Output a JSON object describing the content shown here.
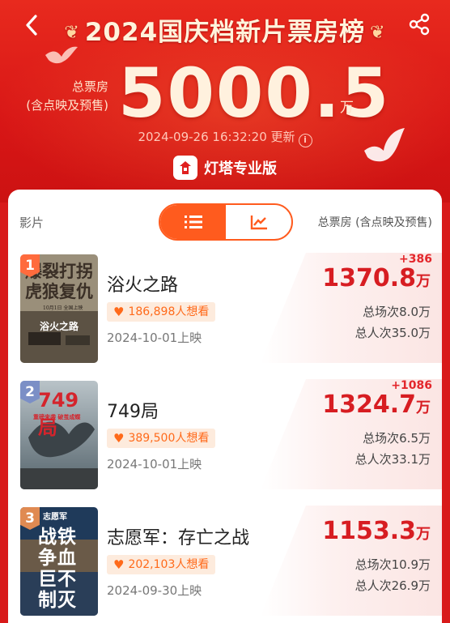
{
  "header": {
    "title": "2024国庆档新片票房榜",
    "total_label_line1": "总票房",
    "total_label_line2": "(含点映及预售)",
    "total_value": "5000.5",
    "total_unit": "万",
    "updated": "2024-09-26 16:32:20 更新",
    "brand": "灯塔专业版",
    "icons": {
      "back": "back-chevron-icon",
      "share": "share-icon",
      "info": "info-icon"
    }
  },
  "list_header": {
    "left": "影片",
    "right": "总票房 (含点映及预售)",
    "toggle": {
      "list_icon": "list-icon",
      "chart_icon": "trend-chart-icon",
      "active": "list"
    }
  },
  "movies": [
    {
      "rank": "1",
      "title": "浴火之路",
      "want": "186,898人想看",
      "release": "2024-10-01上映",
      "delta": "+386",
      "boxoffice": "1370.8",
      "unit": "万",
      "shows": "总场次8.0万",
      "viewers": "总人次35.0万",
      "poster_text": "爆裂虎狼打拐复仇",
      "poster_text_lines": [
        "爆裂打拐",
        "虎狼复仇"
      ],
      "poster_sub": "浴火之路",
      "poster_date": "10月1日 全国上映",
      "rank_color": "#ff6b3d"
    },
    {
      "rank": "2",
      "title": "749局",
      "want": "389,500人想看",
      "release": "2024-10-01上映",
      "delta": "+1086",
      "boxoffice": "1324.7",
      "unit": "万",
      "shows": "总场次6.5万",
      "viewers": "总人次33.1万",
      "poster_text": "749局",
      "poster_tagline": "重磅来袭 破茧成蝶",
      "rank_color": "#7b8fc6"
    },
    {
      "rank": "3",
      "title": "志愿军：存亡之战",
      "want": "202,103人想看",
      "release": "2024-09-30上映",
      "delta": "",
      "boxoffice": "1153.3",
      "unit": "万",
      "shows": "总场次10.9万",
      "viewers": "总人次26.9万",
      "poster_text": "战铁争血巨不制灭",
      "poster_text_lines": [
        "战铁",
        "争血",
        "巨不",
        "制灭"
      ],
      "poster_sub": "志愿军",
      "rank_color": "#e08a52"
    }
  ]
}
